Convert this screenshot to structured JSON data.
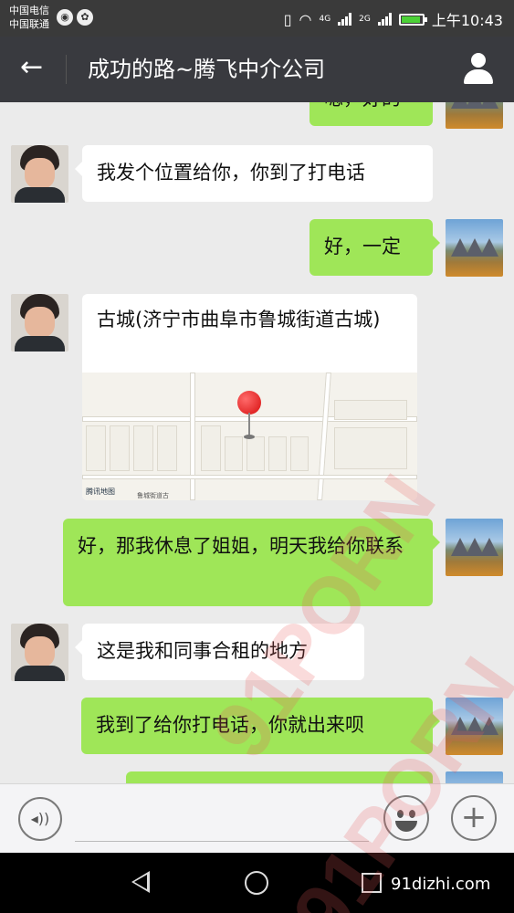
{
  "status_bar": {
    "carrier1": "中国电信",
    "carrier2": "中国联通",
    "time": "上午10:43",
    "net1": "4G",
    "net2": "2G"
  },
  "header": {
    "title": "成功的路~腾飞中介公司",
    "back_icon": "arrow-left-icon",
    "contact_icon": "person-icon"
  },
  "messages": [
    {
      "side": "out",
      "text": "嗯，好的"
    },
    {
      "side": "in",
      "text": "我发个位置给你，你到了打电话"
    },
    {
      "side": "out",
      "text": "好，一定"
    },
    {
      "side": "in",
      "type": "location",
      "text": "古城(济宁市曲阜市鲁城街道古城)",
      "map_brand": "腾讯地图",
      "map_label": "鲁城街道古"
    },
    {
      "side": "out",
      "text": "好，那我休息了姐姐，明天我给你联系"
    },
    {
      "side": "in",
      "text": "这是我和同事合租的地方"
    },
    {
      "side": "out",
      "text": "我到了给你打电话，你就出来呗"
    }
  ],
  "input_bar": {
    "voice_icon": "voice-icon",
    "emoji_icon": "emoji-icon",
    "plus_icon": "plus-icon"
  },
  "watermark": {
    "text": "91PORN",
    "site": "91dizhi.com"
  },
  "colors": {
    "header_bg": "#393a3f",
    "out_bubble": "#9fe658",
    "in_bubble": "#ffffff",
    "chat_bg": "#ebebeb"
  }
}
